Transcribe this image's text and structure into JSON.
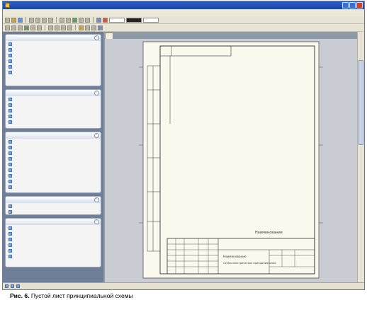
{
  "window": {
    "title": ""
  },
  "menu": [
    "",
    "",
    "",
    "",
    "",
    "",
    "",
    "",
    "",
    "",
    ""
  ],
  "document": {
    "tab_label": ""
  },
  "drawing": {
    "center_title": "Наименование",
    "stamp_title": "Наименование",
    "stamp_sub": "Схема электрическая принципиальная"
  },
  "caption": {
    "figure_label": "Рис. 6.",
    "text": "Пустой лист принципиальной схемы"
  },
  "colors": {
    "panel": "#6f7f9a",
    "sheet": "#fbf9ee",
    "titlebar": "#2f5fc4"
  }
}
